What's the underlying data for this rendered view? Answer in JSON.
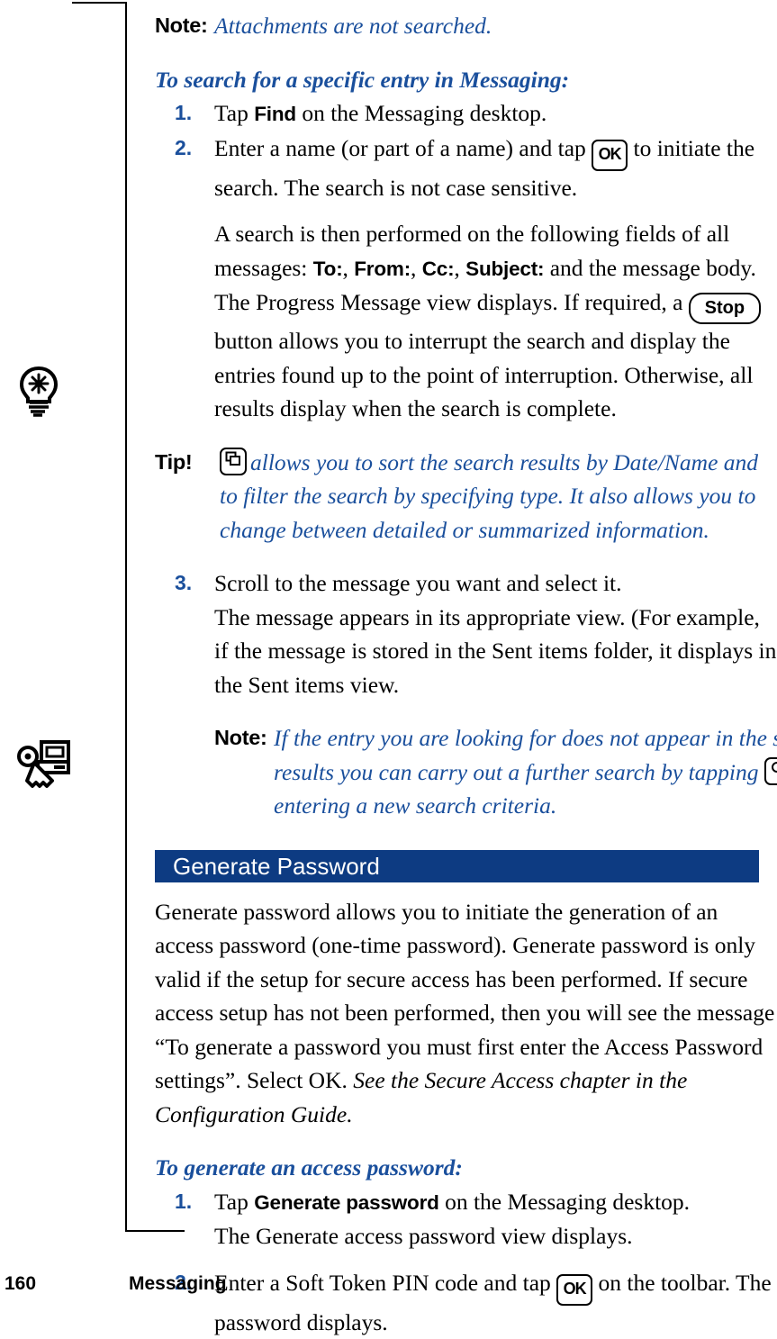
{
  "page": {
    "footer_page_number": "160",
    "footer_chapter_title": "Messaging",
    "accent_blue": "#1a4f9c",
    "header_bar_blue": "#0d3b82"
  },
  "margin_icons": [
    {
      "name": "lightbulb-icon",
      "meaning": "tip"
    },
    {
      "name": "key-and-computer-icon",
      "meaning": "secure-access"
    }
  ],
  "note_1": {
    "lead": "Note:",
    "text": "Attachments are not searched."
  },
  "search_section": {
    "subhead": "To search for a specific entry in Messaging:",
    "step1": {
      "num": "1.",
      "before": "Tap ",
      "ui_label": "Find",
      "after": " on the Messaging desktop."
    },
    "step2": {
      "num": "2.",
      "before": "Enter a name (or part of a name) and tap ",
      "key_ok": "OK",
      "after": " to initiate the search. The search is not case sensitive."
    },
    "body_para": {
      "line_a": "A search is then performed on the following fields of all messages: ",
      "field_to": "To:",
      "sep1": ", ",
      "field_from": "From:",
      "sep2": ", ",
      "field_cc": "Cc:",
      "sep3": ", ",
      "field_subject": "Subject:",
      "line_b": " and the message body. The Progress Message view displays. If required, a ",
      "key_stop": "Stop",
      "line_c": " button allows you to interrupt the search and display the entries found up to the point of interruption. Otherwise, all results display when the search is complete."
    },
    "tip": {
      "lead": "Tip!",
      "icon_name": "cascade-windows-icon",
      "text": "allows you to sort the search results by Date/Name and to filter the search by specifying type. It also allows you to change between detailed or summarized information."
    },
    "step3": {
      "num": "3.",
      "text": "Scroll to the message you want and select it."
    },
    "step3_cont": "The message appears in its appropriate view. (For example, if the message is stored in the Sent items folder, it displays in the Sent items view.",
    "note_2": {
      "lead": "Note:",
      "text_before": "If the entry you are looking for does not appear in the search results you can carry out a further search by tapping ",
      "icon_name": "magnifier-icon",
      "text_after": "and entering a new search criteria."
    }
  },
  "generate_password_section": {
    "header_bar_title": "Generate Password",
    "body_before_italic": "Generate password allows you to initiate the generation of an access password (one-time password). Generate password is only valid if the setup for secure access has been performed. If secure access setup has not been performed, then you will see the message “To generate a password you must first enter the Access Password settings”. Select OK. ",
    "body_italic": "See the Secure Access chapter in the Configuration Guide.",
    "subhead": "To generate an access password:",
    "step1": {
      "num": "1.",
      "before": "Tap ",
      "ui_label": "Generate password",
      "after": " on the Messaging desktop."
    },
    "step1_cont": "The Generate access password view displays.",
    "step2": {
      "num": "2.",
      "before": "Enter a Soft Token PIN code and tap ",
      "key_ok": "OK",
      "after": " on the toolbar. The password displays."
    }
  }
}
